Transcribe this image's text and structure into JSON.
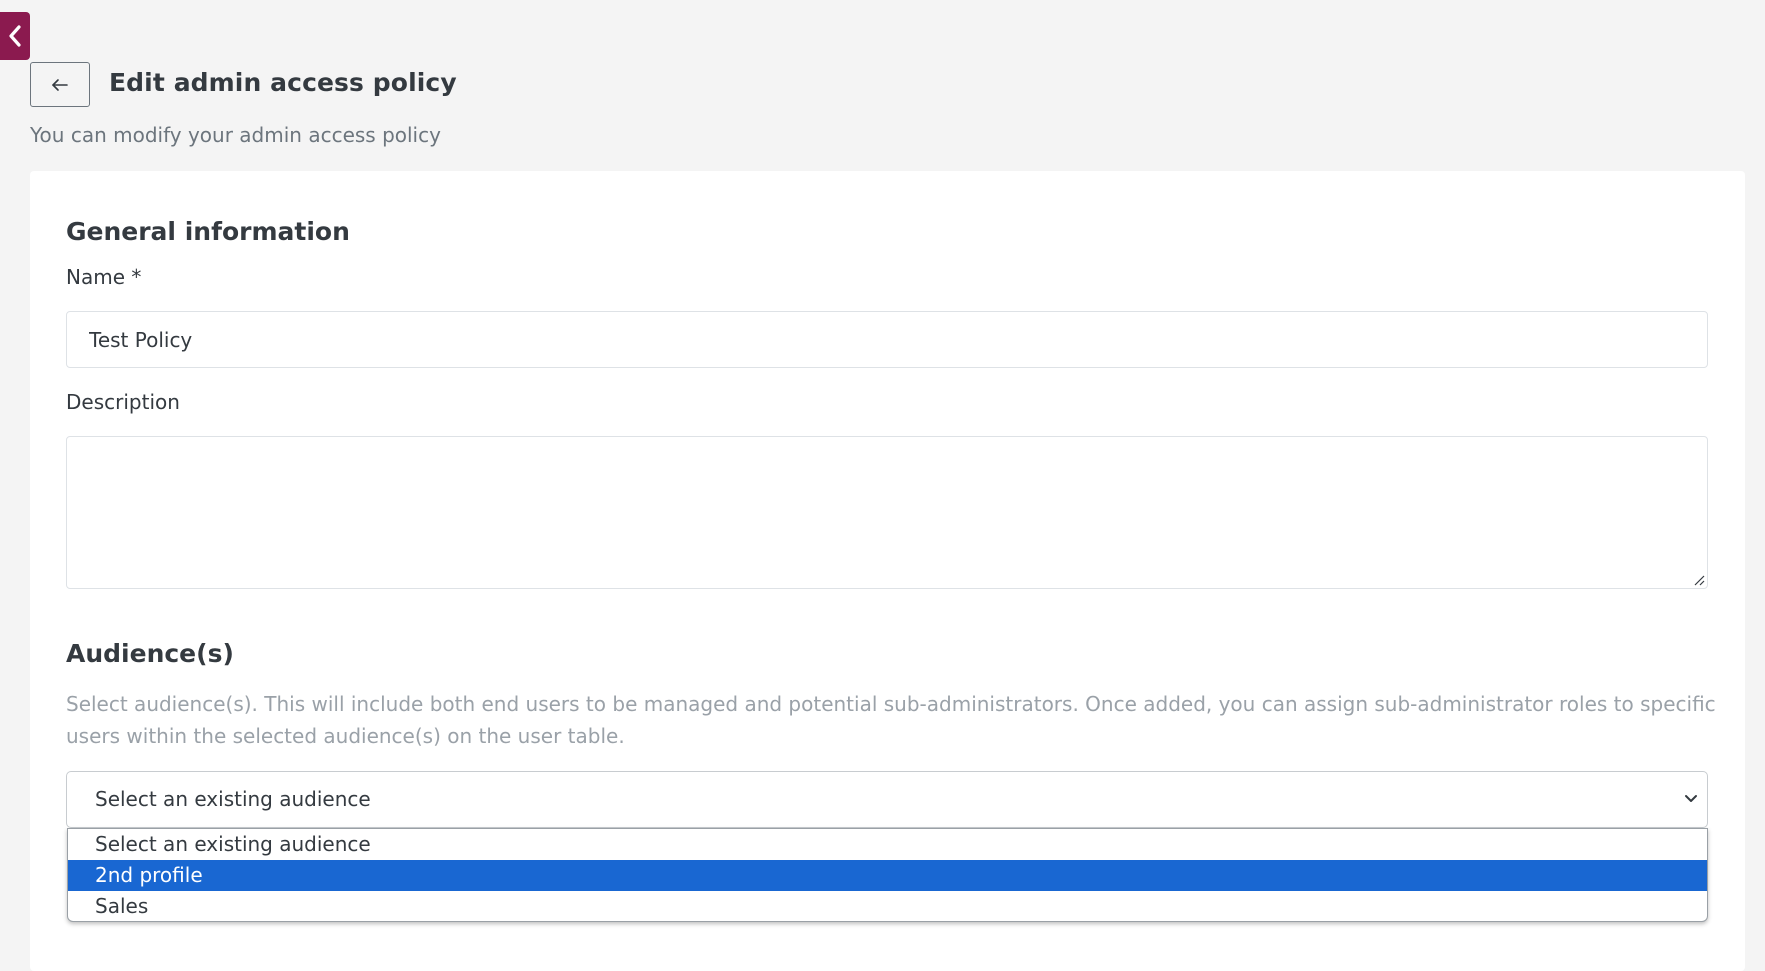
{
  "header": {
    "collapse_icon": "chevron-left-icon",
    "back_icon": "arrow-left-icon",
    "title": "Edit admin access policy",
    "subtitle": "You can modify your admin access policy"
  },
  "general": {
    "section_title": "General information",
    "name_label": "Name *",
    "name_value": "Test Policy",
    "description_label": "Description",
    "description_value": ""
  },
  "audiences": {
    "section_title": "Audience(s)",
    "help_text": "Select audience(s). This will include both end users to be managed and potential sub-administrators. Once added, you can assign sub-administrator roles to specific users within the selected audience(s) on the user table.",
    "select_value": "Select an existing audience",
    "options": [
      {
        "label": "Select an existing audience",
        "selected": false
      },
      {
        "label": "2nd profile",
        "selected": true
      },
      {
        "label": "Sales",
        "selected": false
      }
    ]
  },
  "colors": {
    "accent": "#8b1a4f",
    "highlight": "#1967d2",
    "background": "#f4f4f4"
  }
}
